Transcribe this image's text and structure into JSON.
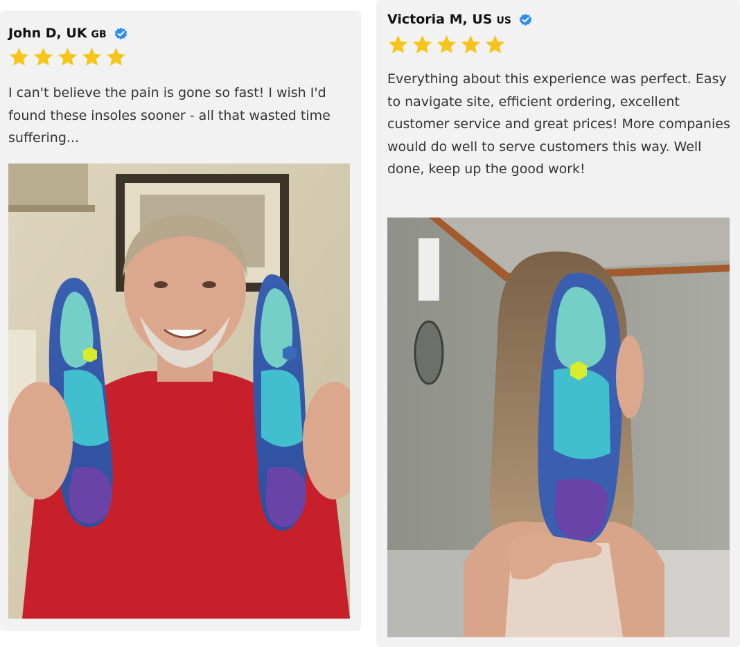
{
  "reviews": [
    {
      "name": "John D, UK",
      "country_code": "GB",
      "rating": 5,
      "text": "I can't believe the pain is gone so fast! I wish I'd found these insoles sooner - all that wasted time suffering...",
      "verified_icon": "verified-check-icon",
      "photo_subject": "man-holding-insoles-photo"
    },
    {
      "name": "Victoria M, US",
      "country_code": "US",
      "rating": 5,
      "text": "Everything about this experience was perfect. Easy to navigate site, efficient ordering, excellent customer service and great prices! More companies would do well to serve customers this way. Well done, keep up the good work!",
      "verified_icon": "verified-check-icon",
      "photo_subject": "woman-holding-insole-photo"
    }
  ],
  "colors": {
    "card_background": "#f2f2f2",
    "star": "#f5c518",
    "verified": "#2d8cf0",
    "text": "#333333",
    "name": "#111111"
  }
}
